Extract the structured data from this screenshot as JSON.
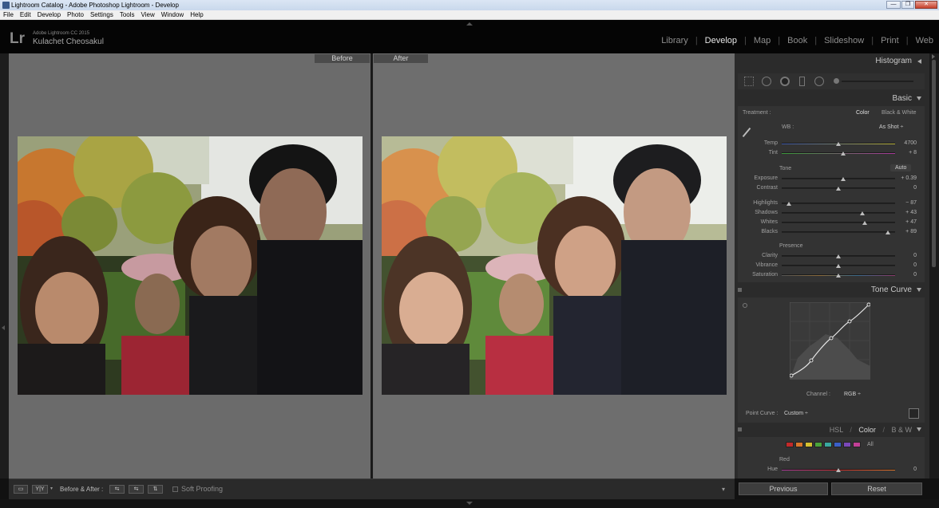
{
  "window": {
    "title": "Lightroom Catalog - Adobe Photoshop Lightroom - Develop",
    "minimize": "—",
    "maximize": "❐",
    "close": "✕"
  },
  "menu": [
    "File",
    "Edit",
    "Develop",
    "Photo",
    "Settings",
    "Tools",
    "View",
    "Window",
    "Help"
  ],
  "identity": {
    "logo": "Lr",
    "product": "Adobe Lightroom CC 2015",
    "user": "Kulachet Cheosakul"
  },
  "modules": [
    "Library",
    "Develop",
    "Map",
    "Book",
    "Slideshow",
    "Print",
    "Web"
  ],
  "active_module": "Develop",
  "viewer": {
    "before_label": "Before",
    "after_label": "After"
  },
  "toolbar": {
    "view_loupe": "▭",
    "view_compare": "Y|Y",
    "before_after_label": "Before & After :",
    "swap1": "⇆",
    "swap2": "⇆",
    "swap3": "⇅",
    "soft_proofing": "Soft Proofing"
  },
  "panels": {
    "histogram": "Histogram",
    "basic": "Basic",
    "treatment_label": "Treatment :",
    "treatment_color": "Color",
    "treatment_bw": "Black & White",
    "wb_label": "WB :",
    "wb_value": "As Shot ÷",
    "tone_label": "Tone",
    "auto_label": "Auto",
    "presence_label": "Presence",
    "tone_curve": "Tone Curve",
    "channel_label": "Channel :",
    "channel_value": "RGB ÷",
    "point_curve_label": "Point Curve :",
    "point_curve_value": "Custom ÷",
    "hsl": "HSL",
    "color": "Color",
    "bw": "B & W",
    "slash1": "/",
    "slash2": "/",
    "hsl_all": "All",
    "hsl_red": "Red",
    "hue": "Hue",
    "previous": "Previous",
    "reset": "Reset"
  },
  "sliders_wb": [
    {
      "label": "Temp",
      "value": "4700",
      "pos": 0.5
    },
    {
      "label": "Tint",
      "value": "+ 8",
      "pos": 0.54
    }
  ],
  "sliders_tone": [
    {
      "label": "Exposure",
      "value": "+ 0.39",
      "pos": 0.54
    },
    {
      "label": "Contrast",
      "value": "0",
      "pos": 0.5
    }
  ],
  "sliders_tone2": [
    {
      "label": "Highlights",
      "value": "− 87",
      "pos": 0.06
    },
    {
      "label": "Shadows",
      "value": "+ 43",
      "pos": 0.71
    },
    {
      "label": "Whites",
      "value": "+ 47",
      "pos": 0.73
    },
    {
      "label": "Blacks",
      "value": "+ 89",
      "pos": 0.94
    }
  ],
  "sliders_presence": [
    {
      "label": "Clarity",
      "value": "0",
      "pos": 0.5
    },
    {
      "label": "Vibrance",
      "value": "0",
      "pos": 0.5
    },
    {
      "label": "Saturation",
      "value": "0",
      "pos": 0.5
    }
  ],
  "slider_hue": {
    "label": "Hue",
    "value": "0",
    "pos": 0.5
  },
  "hsl_swatches": [
    "#c22a2a",
    "#d9762a",
    "#d6c12f",
    "#4aa33a",
    "#39a8a0",
    "#3a5fc8",
    "#7a48b8",
    "#c23f96"
  ],
  "colors": {
    "panel": "#2b2b2b",
    "viewer_bg": "#6a6a6a",
    "text": "#c8c8c8"
  }
}
